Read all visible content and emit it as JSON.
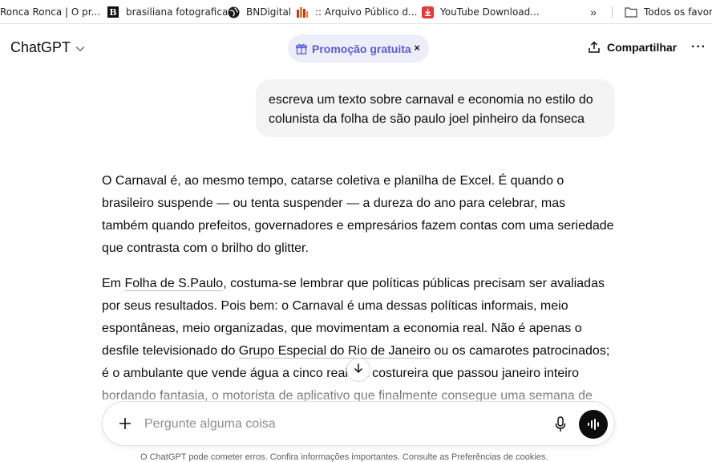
{
  "bookmarks": {
    "items": [
      {
        "label": "Ronca Ronca | O pr...",
        "icon": "none"
      },
      {
        "label": "brasiliana fotografica",
        "icon": "letter-b-icon"
      },
      {
        "label": "BNDigital",
        "icon": "globe-icon"
      },
      {
        "label": ":: Arquivo Público d...",
        "icon": "building-icon"
      },
      {
        "label": "YouTube Download...",
        "icon": "download-icon"
      }
    ],
    "overflow": "»",
    "folder_label": "Todos os favoritos"
  },
  "header": {
    "model_name": "ChatGPT",
    "promo_label": "Promoção gratuita",
    "promo_close": "×",
    "share_label": "Compartilhar",
    "more": "···"
  },
  "conversation": {
    "user_message": "escreva um texto sobre carnaval e economia no estilo do colunista da folha de são paulo joel pinheiro da fonseca",
    "assistant": {
      "p1": "O Carnaval é, ao mesmo tempo, catarse coletiva e planilha de Excel. É quando o brasileiro suspende — ou tenta suspender — a dureza do ano para celebrar, mas também quando prefeitos, governadores e empresários fazem contas com uma seriedade que contrasta com o brilho do glitter.",
      "p2_pre": "Em ",
      "p2_link1": "Folha de S.Paulo",
      "p2_mid": ", costuma-se lembrar que políticas públicas precisam ser avaliadas por seus resultados. Pois bem: o Carnaval é uma dessas políticas informais, meio espontâneas, meio organizadas, que movimentam a economia real. Não é apenas o desfile televisionado do ",
      "p2_link2": "Grupo Especial do Rio de Janeiro",
      "p2_post": " ou os camarotes patrocinados; é o ambulante que vende água a cinco reais, a costureira que passou janeiro inteiro bordando fantasia, o motorista de aplicativo que finalmente consegue uma semana de alta"
    }
  },
  "composer": {
    "placeholder": "Pergunte alguma coisa"
  },
  "footer_note": "O ChatGPT pode cometer erros. Confira informações importantes. Consulte as Preferências de cookies."
}
